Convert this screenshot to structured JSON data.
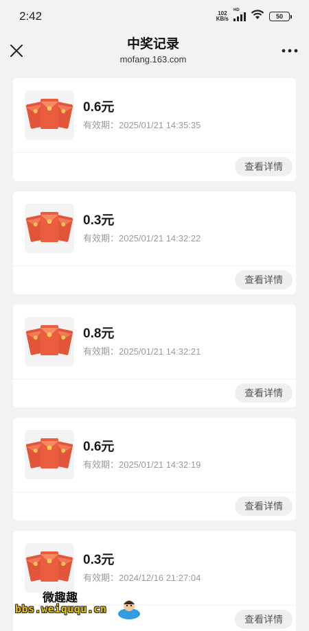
{
  "status": {
    "time": "2:42",
    "net_speed_value": "102",
    "net_speed_unit": "KB/s",
    "signal_label": "HD",
    "battery": "50"
  },
  "nav": {
    "title": "中奖记录",
    "subtitle": "mofang.163.com",
    "close_icon": "close-icon",
    "more_icon": "more-icon"
  },
  "records": [
    {
      "amount": "0.6元",
      "validity_label": "有效期：",
      "validity": "2025/01/21 14:35:35",
      "detail_label": "查看详情"
    },
    {
      "amount": "0.3元",
      "validity_label": "有效期：",
      "validity": "2025/01/21 14:32:22",
      "detail_label": "查看详情"
    },
    {
      "amount": "0.8元",
      "validity_label": "有效期：",
      "validity": "2025/01/21 14:32:21",
      "detail_label": "查看详情"
    },
    {
      "amount": "0.6元",
      "validity_label": "有效期：",
      "validity": "2025/01/21 14:32:19",
      "detail_label": "查看详情"
    },
    {
      "amount": "0.3元",
      "validity_label": "有效期：",
      "validity": "2024/12/16 21:27:04",
      "detail_label": "查看详情"
    }
  ],
  "watermark": {
    "name": "微趣趣",
    "url": "bbs.weiququ.cn"
  },
  "colors": {
    "background": "#f2f2f2",
    "card": "#ffffff",
    "red_packet": "#e8573a",
    "button_bg": "#efefef"
  }
}
